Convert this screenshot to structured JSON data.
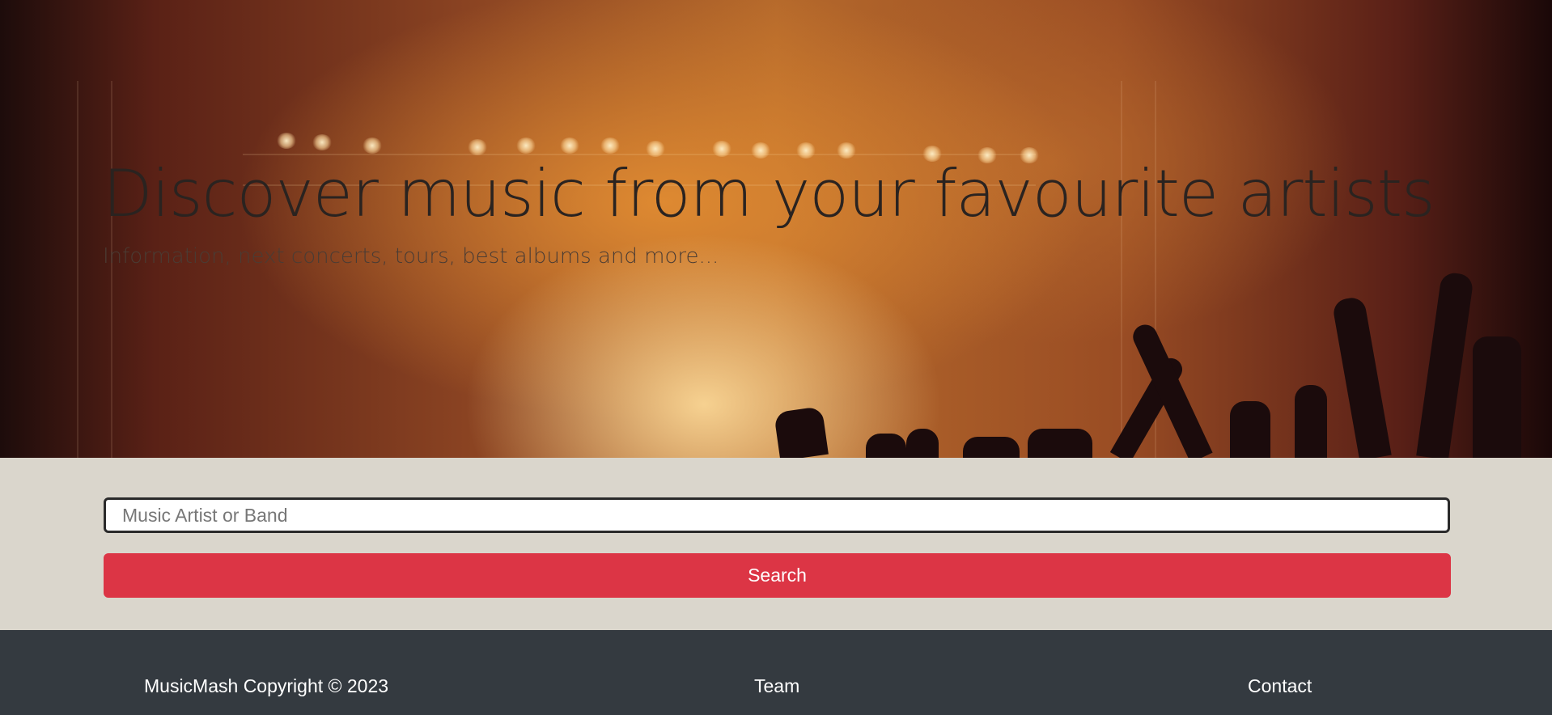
{
  "hero": {
    "title": "Discover music from your favourite artists",
    "subtitle": "Information, next concerts, tours, best albums and more..."
  },
  "search": {
    "placeholder": "Music Artist or Band",
    "value": "",
    "button_label": "Search"
  },
  "footer": {
    "copyright": "MusicMash Copyright © 2023",
    "team_label": "Team",
    "contact_label": "Contact"
  },
  "colors": {
    "search_button": "#dc3545",
    "footer_bg": "#343a40",
    "search_section_bg": "#dad6cc"
  }
}
